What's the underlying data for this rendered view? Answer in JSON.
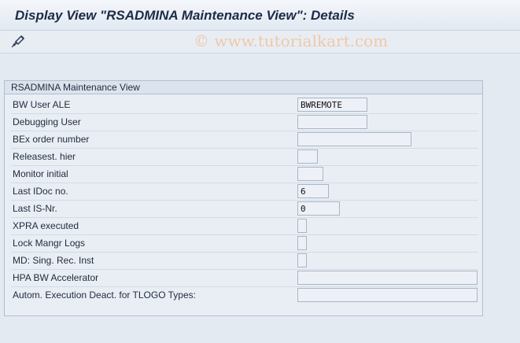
{
  "window": {
    "title": "Display View \"RSADMINA Maintenance View\": Details"
  },
  "watermark": "© www.tutorialkart.com",
  "toolbar": {
    "buttons": [
      {
        "icon": "display-change-icon"
      }
    ]
  },
  "panel": {
    "title": "RSADMINA Maintenance View",
    "fields": [
      {
        "label": "BW User ALE",
        "value": "BWREMOTE"
      },
      {
        "label": "Debugging User",
        "value": ""
      },
      {
        "label": "BEx order number",
        "value": ""
      },
      {
        "label": "Releasest. hier",
        "value": ""
      },
      {
        "label": "Monitor initial",
        "value": ""
      },
      {
        "label": "Last IDoc no.",
        "value": "6"
      },
      {
        "label": "Last IS-Nr.",
        "value": "0"
      },
      {
        "label": "XPRA executed",
        "value": ""
      },
      {
        "label": "Lock Mangr Logs",
        "value": ""
      },
      {
        "label": "MD: Sing. Rec. Inst",
        "value": ""
      },
      {
        "label": "HPA BW Accelerator",
        "value": ""
      },
      {
        "label": "Autom. Execution Deact. for TLOGO Types:",
        "value": ""
      }
    ]
  }
}
